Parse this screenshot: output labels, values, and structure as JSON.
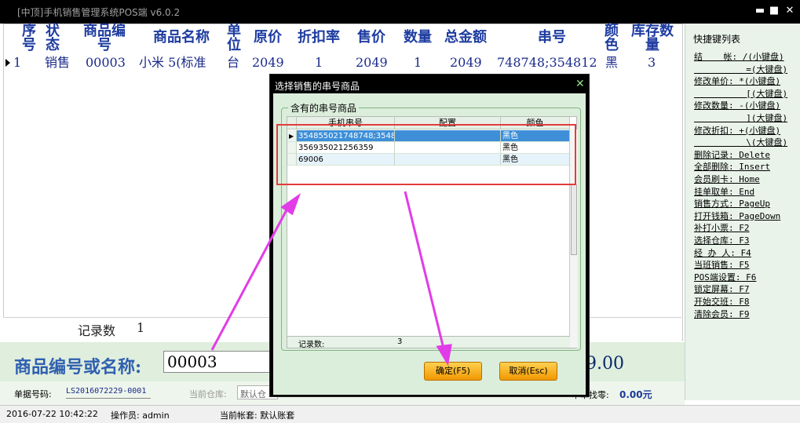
{
  "window": {
    "title": "[中顶]手机销售管理系统POS端 v6.0.2",
    "minimize": "▬",
    "maximize": "■",
    "close": "✕"
  },
  "grid": {
    "headers": {
      "seq": "序号",
      "status": "状态",
      "code": "商品编号",
      "name": "商品名称",
      "unit": "单位",
      "price": "原价",
      "discount": "折扣率",
      "sale": "售价",
      "qty": "数量",
      "total": "总金额",
      "serial": "串号",
      "color": "颜色",
      "stock": "库存数量"
    },
    "row": {
      "seq": "1",
      "status": "销售",
      "code": "00003",
      "name": "小米 5(标准",
      "unit": "台",
      "price": "2049",
      "discount": "1",
      "sale": "2049",
      "qty": "1",
      "total": "2049",
      "serial": "748748;354812",
      "color": "黑",
      "stock": "3"
    },
    "footer_label": "记录数",
    "footer_value": "1"
  },
  "shortcuts": {
    "title": "快捷键列表",
    "items": [
      "结    帐: /(小键盘)",
      "          =(大键盘)",
      "修改单价: *(小键盘)",
      "          [(大键盘)",
      "修改数量: -(小键盘)",
      "          ](大键盘)",
      "修改折扣: +(小键盘)",
      "          \\(大键盘)",
      "删除记录: Delete",
      "全部删除: Insert",
      "会员刷卡: Home",
      "挂单取单: End",
      "销售方式: PageUp",
      "打开钱箱: PageDown",
      "补打小票: F2",
      "选择仓库: F3",
      "经 办 人: F4",
      "当班销售: F5",
      "POS端设置: F6",
      "锁定屏幕: F7",
      "开始交班: F8",
      "清除会员: F9"
    ]
  },
  "input": {
    "label": "商品编号或名称:",
    "value": "00003",
    "total": "9.00"
  },
  "info": {
    "bill_label": "单据号码:",
    "bill_value": "LS2016072229-0001",
    "warehouse_label": "当前仓库:",
    "warehouse_value": "默认仓",
    "change_label": "本单找零:",
    "change_value": "0.00元"
  },
  "status": {
    "datetime": "2016-07-22 10:42:22",
    "operator": "操作员: admin",
    "account": "当前帐套: 默认账套"
  },
  "dialog": {
    "title": "选择销售的串号商品",
    "close": "✕",
    "group_title": "含有的串号商品",
    "columns": [
      "手机串号",
      "配置",
      "颜色"
    ],
    "rows": [
      {
        "serial": "354855021748748;3548",
        "config": "",
        "color": "黑色"
      },
      {
        "serial": "356935021256359",
        "config": "",
        "color": "黑色"
      },
      {
        "serial": "69006",
        "config": "",
        "color": "黑色"
      }
    ],
    "footer_label": "记录数:",
    "footer_value": "3",
    "ok_label": "确定(F5)",
    "cancel_label": "取消(Esc)"
  }
}
